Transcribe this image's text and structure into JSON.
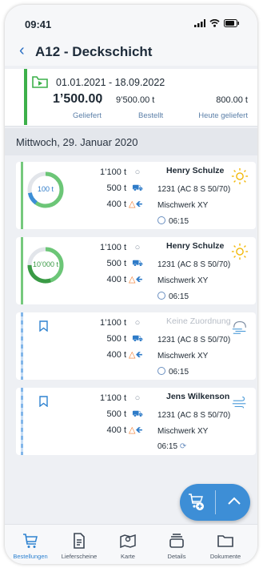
{
  "status_bar": {
    "time": "09:41"
  },
  "header": {
    "title": "A12 - Deckschicht"
  },
  "summary": {
    "date_range": "01.01.2021  -  18.09.2022",
    "delivered_value": "1’500.00",
    "separator": "/",
    "ordered_value": "9’500.00 t",
    "today_value": "800.00 t",
    "delivered_label": "Geliefert",
    "ordered_label": "Bestellt",
    "today_label": "Heute geliefert"
  },
  "day_header": "Mittwoch, 29. Januar 2020",
  "orders": [
    {
      "ring": "100 t",
      "ring_progress": 0.65,
      "q1": "1’100 t",
      "q2": "500 t",
      "q3": "400 t",
      "driver": "Henry Schulze",
      "assigned": true,
      "job": "1231 (AC 8 S 50/70)",
      "plant": "Mischwerk XY",
      "time": "06:15",
      "weather": "sun-icon"
    },
    {
      "ring": "10’000 t",
      "ring_progress": 0.75,
      "q1": "1’100 t",
      "q2": "500 t",
      "q3": "400 t",
      "driver": "Henry Schulze",
      "assigned": true,
      "job": "1231 (AC 8 S 50/70)",
      "plant": "Mischwerk XY",
      "time": "06:15",
      "weather": "sun-icon"
    },
    {
      "q1": "1’100 t",
      "q2": "500 t",
      "q3": "400 t",
      "driver": "Keine Zuordnung",
      "assigned": false,
      "job": "1231 (AC 8 S 50/70)",
      "plant": "Mischwerk XY",
      "time": "06:15",
      "weather": "cloud-wind-icon"
    },
    {
      "q1": "1’100 t",
      "q2": "500 t",
      "q3": "400 t",
      "driver": "Jens Wilkenson",
      "assigned": true,
      "job": "1231 (AC 8 S 50/70)",
      "plant": "Mischwerk XY",
      "time": "06:15",
      "weather": "wind-icon"
    }
  ],
  "colors": {
    "accent": "#3d8ed6",
    "delivered": "#3cb04a",
    "cone": "#f07a2c"
  },
  "nav": [
    {
      "label": "Bestellungen",
      "icon": "cart-icon",
      "active": true
    },
    {
      "label": "Lieferscheine",
      "icon": "document-icon",
      "active": false
    },
    {
      "label": "Karte",
      "icon": "map-icon",
      "active": false
    },
    {
      "label": "Details",
      "icon": "details-icon",
      "active": false
    },
    {
      "label": "Dokumente",
      "icon": "folder-icon",
      "active": false
    }
  ]
}
